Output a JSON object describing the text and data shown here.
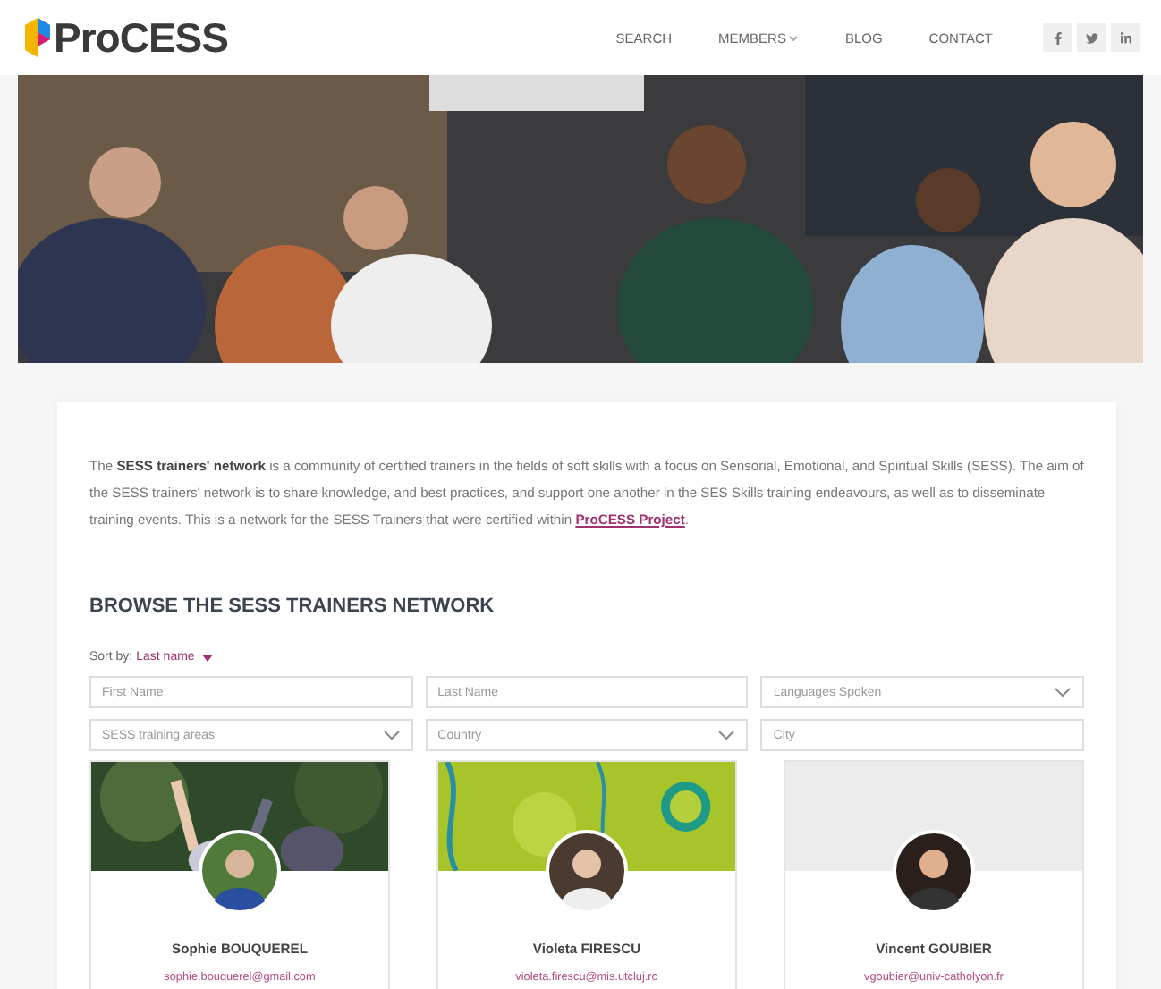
{
  "header": {
    "logo": "ProCESS",
    "nav": [
      {
        "label": "SEARCH",
        "kind": "link"
      },
      {
        "label": "MEMBERS",
        "kind": "dropdown"
      },
      {
        "label": "BLOG",
        "kind": "link"
      },
      {
        "label": "CONTACT",
        "kind": "link"
      }
    ],
    "social": [
      {
        "kind": "facebook"
      },
      {
        "kind": "twitter"
      },
      {
        "kind": "linkedin"
      }
    ]
  },
  "intro": {
    "text": "The **SESS trainers' network** is a community of certified trainers in the fields of soft skills with a focus on Sensorial, Emotional, and Spiritual Skills (SESS). The aim of the SESS trainers' network is to share knowledge, and best practices, and support one another in the SES Skills training endeavours, as well as to disseminate training events. This is a network for the SESS Trainers that were certified within",
    "link": "ProCESS Project",
    "end": "."
  },
  "browse": {
    "title": "BROWSE THE SESS TRAINERS NETWORK",
    "sort_label": "Sort by:",
    "sort_value": "Last name",
    "filters": [
      {
        "placeholder": "First Name",
        "kind": "text"
      },
      {
        "placeholder": "Last Name",
        "kind": "text"
      },
      {
        "placeholder": "Languages Spoken",
        "kind": "select"
      },
      {
        "placeholder": "SESS training areas",
        "kind": "select"
      },
      {
        "placeholder": "Country",
        "kind": "select"
      },
      {
        "placeholder": "City",
        "kind": "text"
      }
    ]
  },
  "members": [
    {
      "name": "Sophie BOUQUEREL",
      "email": "sophie.bouquerel@gmail.com"
    },
    {
      "name": "Violeta FIRESCU",
      "email": "violeta.firescu@mis.utcluj.ro",
      "cover": {
        "kind": "abstract"
      }
    },
    {
      "name": "Vincent GOUBIER",
      "email": "vgoubier@univ-catholyon.fr",
      "cover": {
        "kind": "none"
      }
    }
  ]
}
